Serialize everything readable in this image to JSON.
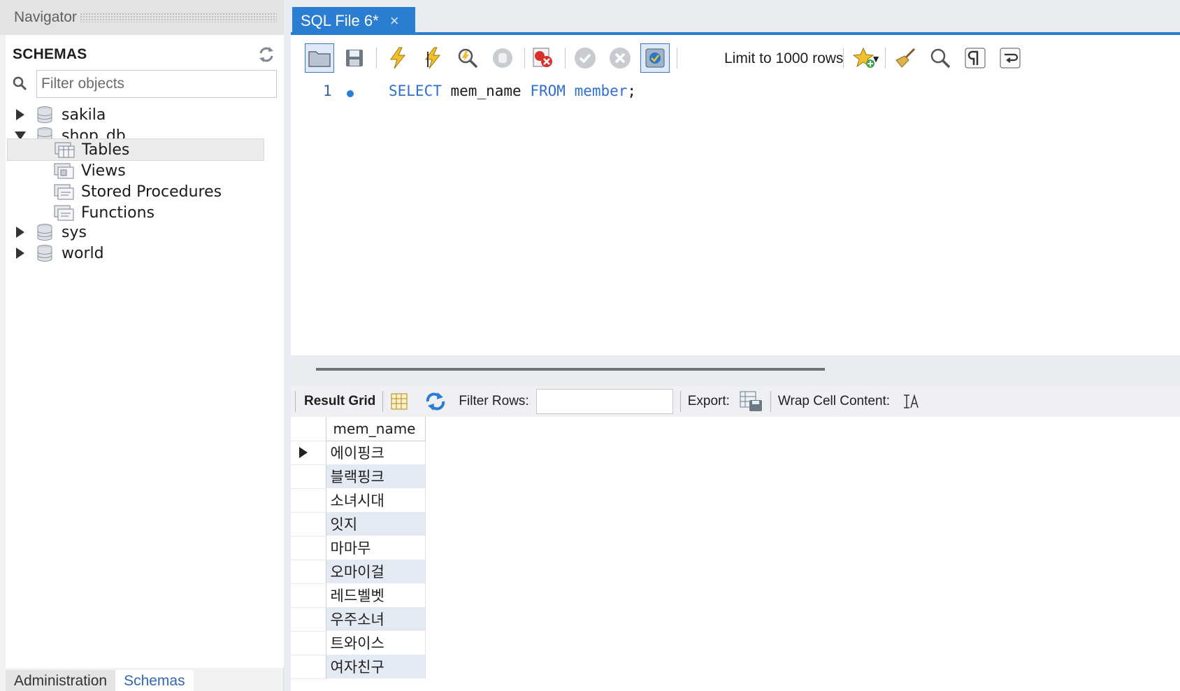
{
  "navigator": {
    "title": "Navigator",
    "schemas_title": "SCHEMAS",
    "filter_placeholder": "Filter objects",
    "tree": {
      "sakila": "sakila",
      "shop_db": "shop_db",
      "tables": "Tables",
      "views": "Views",
      "procs": "Stored Procedures",
      "functions": "Functions",
      "sys": "sys",
      "world": "world"
    },
    "tabs": {
      "administration": "Administration",
      "schemas": "Schemas"
    }
  },
  "editor": {
    "tab_title": "SQL File 6*",
    "tab_close": "×",
    "limit_label": "Limit to 1000 rows",
    "line_number": "1",
    "sql": {
      "kw_select": "SELECT",
      "column": "mem_name",
      "kw_from": "FROM",
      "table": "member",
      "semicolon": ";"
    }
  },
  "results": {
    "result_grid_label": "Result Grid",
    "filter_rows_label": "Filter Rows:",
    "filter_rows_value": "",
    "export_label": "Export:",
    "wrap_label": "Wrap Cell Content:",
    "column_header": "mem_name",
    "rows": [
      "에이핑크",
      "블랙핑크",
      "소녀시대",
      "잇지",
      "마마무",
      "오마이걸",
      "레드벨벳",
      "우주소녀",
      "트와이스",
      "여자친구"
    ]
  },
  "colors": {
    "accent": "#2a7dd0",
    "keyword": "#2f6fcf",
    "alt_row": "#e4eaf3"
  }
}
